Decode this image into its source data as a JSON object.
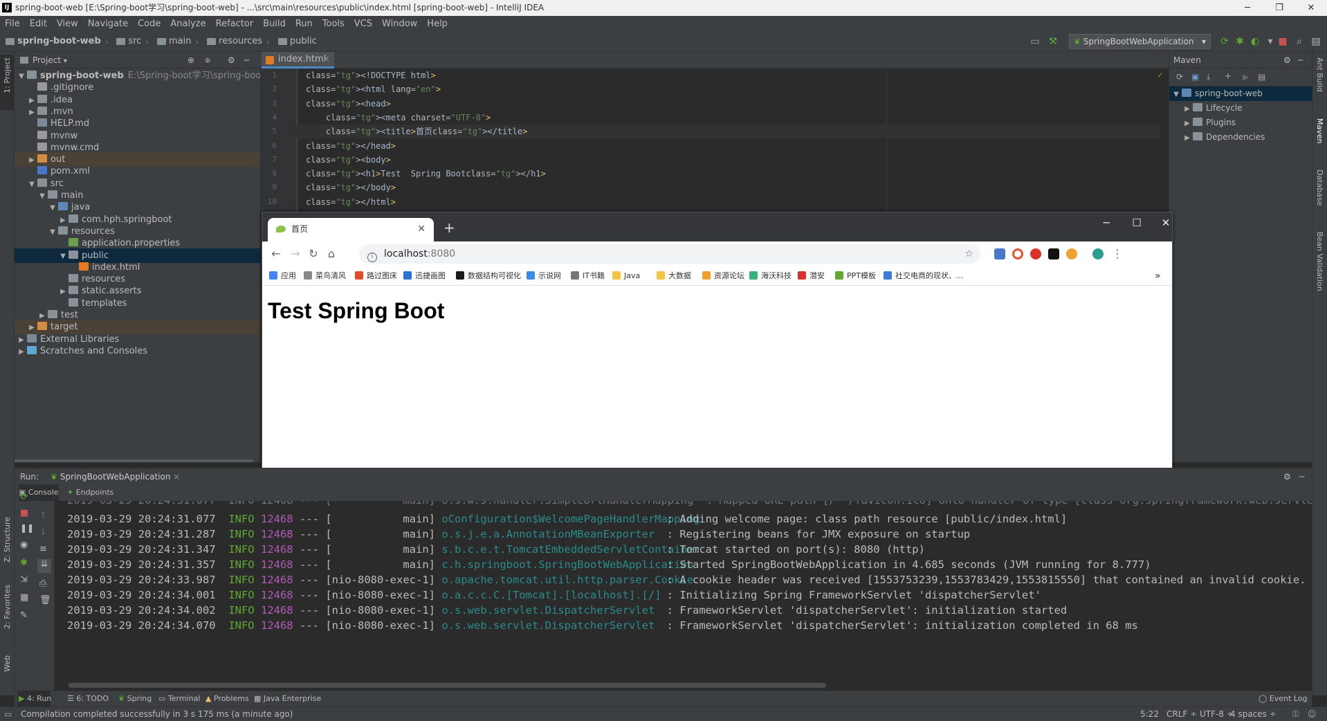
{
  "window": {
    "title": "spring-boot-web [E:\\Spring-boot学习\\spring-boot-web] - ...\\src\\main\\resources\\public\\index.html [spring-boot-web] - IntelliJ IDEA",
    "logo": "IJ",
    "minimize": "─",
    "restore": "❐",
    "close": "✕"
  },
  "menu": [
    "File",
    "Edit",
    "View",
    "Navigate",
    "Code",
    "Analyze",
    "Refactor",
    "Build",
    "Run",
    "Tools",
    "VCS",
    "Window",
    "Help"
  ],
  "breadcrumb": [
    "spring-boot-web",
    "src",
    "main",
    "resources",
    "public"
  ],
  "run_config": "SpringBootWebApplication",
  "left_strip": {
    "project": "1: Project",
    "structure": "Z: Structure",
    "favorites": "2: Favorites",
    "web": "Web"
  },
  "right_strip": {
    "ant": "Ant Build",
    "maven": "Maven",
    "database": "Database",
    "bean": "Bean Validation"
  },
  "project": {
    "title": "Project",
    "rows": [
      {
        "arrow": "▼",
        "label": "spring-boot-web",
        "extra": "E:\\Spring-boot学习\\spring-boot-we",
        "indent": 0,
        "icon": "folder",
        "bold": true
      },
      {
        "arrow": "",
        "label": ".gitignore",
        "indent": 1,
        "icon": "file"
      },
      {
        "arrow": "▶",
        "label": ".idea",
        "indent": 1,
        "icon": "folder"
      },
      {
        "arrow": "▶",
        "label": ".mvn",
        "indent": 1,
        "icon": "folder"
      },
      {
        "arrow": "",
        "label": "HELP.md",
        "indent": 1,
        "icon": "md"
      },
      {
        "arrow": "",
        "label": "mvnw",
        "indent": 1,
        "icon": "file"
      },
      {
        "arrow": "",
        "label": "mvnw.cmd",
        "indent": 1,
        "icon": "file"
      },
      {
        "arrow": "▶",
        "label": "out",
        "indent": 1,
        "icon": "orange",
        "hl": true
      },
      {
        "arrow": "",
        "label": "pom.xml",
        "indent": 1,
        "icon": "maven"
      },
      {
        "arrow": "▼",
        "label": "src",
        "indent": 1,
        "icon": "folder"
      },
      {
        "arrow": "▼",
        "label": "main",
        "indent": 2,
        "icon": "folder"
      },
      {
        "arrow": "▼",
        "label": "java",
        "indent": 3,
        "icon": "blue"
      },
      {
        "arrow": "▶",
        "label": "com.hph.springboot",
        "indent": 4,
        "icon": "folder"
      },
      {
        "arrow": "▼",
        "label": "resources",
        "indent": 3,
        "icon": "folder"
      },
      {
        "arrow": "",
        "label": "application.properties",
        "indent": 4,
        "icon": "spring"
      },
      {
        "arrow": "▼",
        "label": "public",
        "indent": 4,
        "icon": "folder",
        "sel": true
      },
      {
        "arrow": "",
        "label": "index.html",
        "indent": 5,
        "icon": "html"
      },
      {
        "arrow": "",
        "label": "resources",
        "indent": 4,
        "icon": "folder"
      },
      {
        "arrow": "▶",
        "label": "static.asserts",
        "indent": 4,
        "icon": "folder"
      },
      {
        "arrow": "",
        "label": "templates",
        "indent": 4,
        "icon": "folder"
      },
      {
        "arrow": "▶",
        "label": "test",
        "indent": 2,
        "icon": "folder"
      },
      {
        "arrow": "▶",
        "label": "target",
        "indent": 1,
        "icon": "orange",
        "hl": true
      },
      {
        "arrow": "▶",
        "label": "External Libraries",
        "indent": 0,
        "icon": "lib"
      },
      {
        "arrow": "▶",
        "label": "Scratches and Consoles",
        "indent": 0,
        "icon": "scratch"
      }
    ]
  },
  "editor": {
    "tab": "index.html",
    "lines": [
      "<!DOCTYPE html>",
      "<html lang=\"en\">",
      "<head>",
      "    <meta charset=\"UTF-8\">",
      "    <title>首页</title>",
      "</head>",
      "<body>",
      "<h1>Test  Spring Boot</h1>",
      "</body>",
      "</html>"
    ],
    "numbers": [
      "1",
      "2",
      "3",
      "4",
      "5",
      "6",
      "7",
      "8",
      "9",
      "10"
    ]
  },
  "maven": {
    "title": "Maven",
    "root": "spring-boot-web",
    "items": [
      "Lifecycle",
      "Plugins",
      "Dependencies"
    ]
  },
  "browser": {
    "tab_title": "首页",
    "url_host": "localhost",
    "url_port": ":8080",
    "bookmarks": [
      "应用",
      "菜鸟清风",
      "路过图床",
      "迅捷画图",
      "数据结构可视化",
      "示说网",
      "IT书籍",
      "Java",
      "大数据",
      "资源论坛",
      "海沃科技",
      "潜安",
      "PPT模板",
      "社交电商的现状、..."
    ],
    "bookmark_more": "»",
    "heading": "Test Spring Boot"
  },
  "run": {
    "label": "Run:",
    "config": "SpringBootWebApplication",
    "console": "Console",
    "endpoints": "Endpoints"
  },
  "log": [
    {
      "ts": "2019-03-29 20:24:31.077",
      "lvl": "INFO",
      "pid": "12468",
      "sep": "---",
      "thread": "[           main]",
      "logger": "oConfiguration$WelcomePageHandlerMapping",
      "msg": ": Adding welcome page: class path resource [public/index.html]"
    },
    {
      "ts": "2019-03-29 20:24:31.287",
      "lvl": "INFO",
      "pid": "12468",
      "sep": "---",
      "thread": "[           main]",
      "logger": "o.s.j.e.a.AnnotationMBeanExporter",
      "msg": ": Registering beans for JMX exposure on startup"
    },
    {
      "ts": "2019-03-29 20:24:31.347",
      "lvl": "INFO",
      "pid": "12468",
      "sep": "---",
      "thread": "[           main]",
      "logger": "s.b.c.e.t.TomcatEmbeddedServletContainer",
      "msg": ": Tomcat started on port(s): 8080 (http)"
    },
    {
      "ts": "2019-03-29 20:24:31.357",
      "lvl": "INFO",
      "pid": "12468",
      "sep": "---",
      "thread": "[           main]",
      "logger": "c.h.springboot.SpringBootWebApplication",
      "msg": ": Started SpringBootWebApplication in 4.685 seconds (JVM running for 8.777)"
    },
    {
      "ts": "2019-03-29 20:24:33.987",
      "lvl": "INFO",
      "pid": "12468",
      "sep": "---",
      "thread": "[nio-8080-exec-1]",
      "logger": "o.apache.tomcat.util.http.parser.Cookie",
      "msg": ": A cookie header was received [1553753239,1553783429,1553815550] that contained an invalid cookie. T"
    },
    {
      "ts": "2019-03-29 20:24:34.001",
      "lvl": "INFO",
      "pid": "12468",
      "sep": "---",
      "thread": "[nio-8080-exec-1]",
      "logger": "o.a.c.c.C.[Tomcat].[localhost].[/]",
      "msg": ": Initializing Spring FrameworkServlet 'dispatcherServlet'"
    },
    {
      "ts": "2019-03-29 20:24:34.002",
      "lvl": "INFO",
      "pid": "12468",
      "sep": "---",
      "thread": "[nio-8080-exec-1]",
      "logger": "o.s.web.servlet.DispatcherServlet",
      "msg": ": FrameworkServlet 'dispatcherServlet': initialization started"
    },
    {
      "ts": "2019-03-29 20:24:34.070",
      "lvl": "INFO",
      "pid": "12468",
      "sep": "---",
      "thread": "[nio-8080-exec-1]",
      "logger": "o.s.web.servlet.DispatcherServlet",
      "msg": ": FrameworkServlet 'dispatcherServlet': initialization completed in 68 ms"
    }
  ],
  "bottom_tabs": [
    "4: Run",
    "6: TODO",
    "Spring",
    "Terminal",
    "Problems",
    "Java Enterprise"
  ],
  "event_log": "Event Log",
  "status": {
    "message": "Compilation completed successfully in 3 s 175 ms (a minute ago)",
    "pos": "5:22",
    "crlf": "CRLF ÷",
    "enc": "UTF-8 ÷",
    "indent": "4 spaces ÷"
  }
}
